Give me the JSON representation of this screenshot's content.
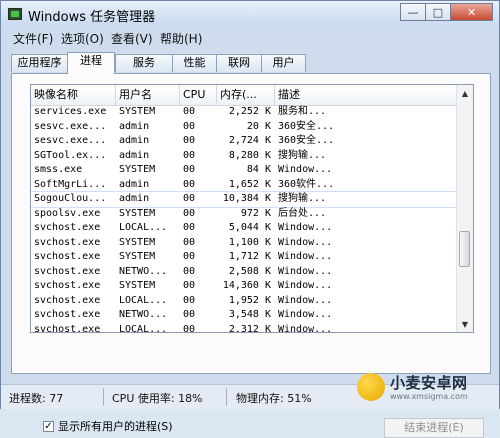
{
  "window": {
    "title": "Windows 任务管理器",
    "controls": [
      "—",
      "□",
      "✕"
    ]
  },
  "menu": [
    "文件(F)",
    "选项(O)",
    "查看(V)",
    "帮助(H)"
  ],
  "tabs": [
    "应用程序",
    "进程",
    "服务",
    "性能",
    "联网",
    "用户"
  ],
  "active_tab": "进程",
  "table": {
    "columns": [
      "映像名称",
      "用户名",
      "CPU",
      "内存(...",
      "描述"
    ],
    "rows": [
      [
        "services.exe",
        "SYSTEM",
        "00",
        "2,252 K",
        "服务和..."
      ],
      [
        "sesvc.exe...",
        "admin",
        "00",
        "20 K",
        "360安全..."
      ],
      [
        "sesvc.exe...",
        "admin",
        "00",
        "2,724 K",
        "360安全..."
      ],
      [
        "SGTool.ex...",
        "admin",
        "00",
        "8,280 K",
        "搜狗输..."
      ],
      [
        "smss.exe",
        "SYSTEM",
        "00",
        "84 K",
        "Window..."
      ],
      [
        "SoftMgrLi...",
        "admin",
        "00",
        "1,652 K",
        "360软件..."
      ],
      [
        "SogouClou...",
        "admin",
        "00",
        "10,384 K",
        "搜狗输..."
      ],
      [
        "spoolsv.exe",
        "SYSTEM",
        "00",
        "972 K",
        "后台处..."
      ],
      [
        "svchost.exe",
        "LOCAL...",
        "00",
        "5,044 K",
        "Window..."
      ],
      [
        "svchost.exe",
        "SYSTEM",
        "00",
        "1,100 K",
        "Window..."
      ],
      [
        "svchost.exe",
        "SYSTEM",
        "00",
        "1,712 K",
        "Window..."
      ],
      [
        "svchost.exe",
        "NETWO...",
        "00",
        "2,508 K",
        "Window..."
      ],
      [
        "svchost.exe",
        "SYSTEM",
        "00",
        "14,360 K",
        "Window..."
      ],
      [
        "svchost.exe",
        "LOCAL...",
        "00",
        "1,952 K",
        "Window..."
      ],
      [
        "svchost.exe",
        "NETWO...",
        "00",
        "3,548 K",
        "Window..."
      ],
      [
        "svchost.exe",
        "LOCAL...",
        "00",
        "2,312 K",
        "Window..."
      ]
    ],
    "selected_row": 6
  },
  "show_all_users": {
    "label": "显示所有用户的进程(S)",
    "checked": true
  },
  "end_process_button": "结束进程(E)",
  "status": {
    "processes": "进程数: 77",
    "cpu": "CPU 使用率: 18%",
    "memory": "物理内存: 51%"
  },
  "watermark": {
    "title": "小麦安卓网",
    "url": "www.xmsigma.com"
  }
}
